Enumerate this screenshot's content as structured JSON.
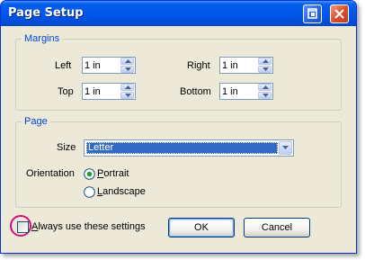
{
  "window": {
    "title": "Page Setup"
  },
  "margins": {
    "legend": "Margins",
    "left": {
      "label": "Left",
      "value": "1 in"
    },
    "right": {
      "label": "Right",
      "value": "1 in"
    },
    "top": {
      "label": "Top",
      "value": "1 in"
    },
    "bottom": {
      "label": "Bottom",
      "value": "1 in"
    }
  },
  "page": {
    "legend": "Page",
    "size_label": "Size",
    "size_value": "Letter",
    "orientation_label": "Orientation",
    "portrait": {
      "first": "P",
      "rest": "ortrait",
      "selected": true
    },
    "landscape": {
      "first": "L",
      "rest": "andscape",
      "selected": false
    }
  },
  "footer": {
    "always_use_first": "A",
    "always_use_rest": "lways use these settings",
    "always_use_checked": false,
    "ok_label": "OK",
    "cancel_label": "Cancel"
  },
  "colors": {
    "title_bar": "#0058ee",
    "group_legend": "#0046d5",
    "selection": "#316ac5",
    "highlight_ring": "#d6107a"
  },
  "icons": {
    "restore": "restore-window-icon",
    "close": "close-icon",
    "spin_up": "chevron-up-icon",
    "spin_down": "chevron-down-icon",
    "dropdown": "chevron-down-icon"
  }
}
